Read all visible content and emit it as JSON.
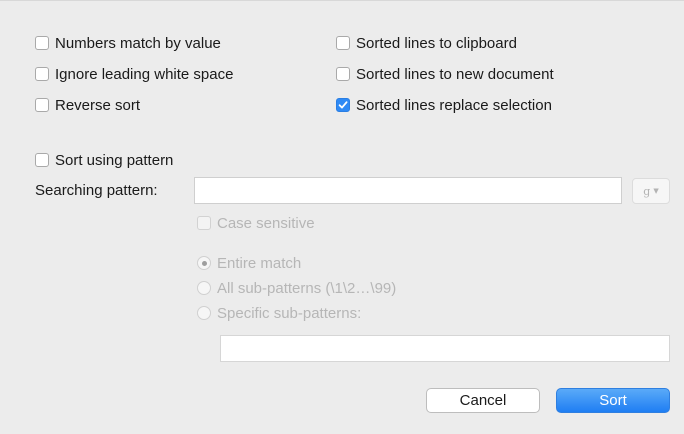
{
  "options_left": [
    {
      "label": "Numbers match by value",
      "checked": false
    },
    {
      "label": "Ignore leading white space",
      "checked": false
    },
    {
      "label": "Reverse sort",
      "checked": false
    }
  ],
  "options_right": [
    {
      "label": "Sorted lines to clipboard",
      "checked": false
    },
    {
      "label": "Sorted lines to new document",
      "checked": false
    },
    {
      "label": "Sorted lines replace selection",
      "checked": true
    }
  ],
  "pattern": {
    "sort_using_pattern_label": "Sort using pattern",
    "sort_using_pattern_checked": false,
    "searching_pattern_label": "Searching pattern:",
    "searching_pattern_value": "",
    "regex_button_label": "g",
    "case_sensitive_label": "Case sensitive",
    "case_sensitive_checked": false,
    "match_options": [
      {
        "label": "Entire match",
        "selected": true
      },
      {
        "label": "All sub-patterns (\\1\\2…\\99)",
        "selected": false
      },
      {
        "label": "Specific sub-patterns:",
        "selected": false
      }
    ],
    "specific_subpatterns_value": ""
  },
  "buttons": {
    "cancel_label": "Cancel",
    "sort_label": "Sort"
  },
  "colors": {
    "accent": "#2f8af5",
    "background": "#ececec",
    "disabled_text": "#b6b6b6"
  }
}
